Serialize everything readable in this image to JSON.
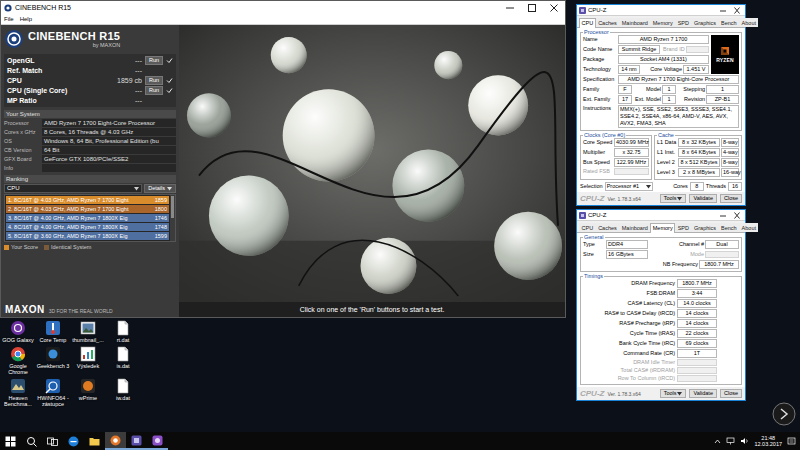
{
  "desktop": {
    "icons": [
      {
        "label": "GOG Galaxy",
        "kind": "gog"
      },
      {
        "label": "Core Temp",
        "kind": "coretemp"
      },
      {
        "label": "thumbnail_...",
        "kind": "image"
      },
      {
        "label": "rt.dat",
        "kind": "file"
      },
      {
        "label": "Google Chrome",
        "kind": "chrome"
      },
      {
        "label": "Geekbench 3",
        "kind": "geekbench"
      },
      {
        "label": "Výsledek",
        "kind": "chart"
      },
      {
        "label": "is.dat",
        "kind": "file"
      },
      {
        "label": "Heaven Benchma...",
        "kind": "heaven"
      },
      {
        "label": "HWiNFO64 - zástupce",
        "kind": "hwinfo"
      },
      {
        "label": "wPrime",
        "kind": "wprime"
      },
      {
        "label": "iw.dat",
        "kind": "file"
      }
    ]
  },
  "cinebench": {
    "title": "CINEBENCH R15",
    "menu": [
      "File",
      "Help"
    ],
    "logo": {
      "name": "CINEBENCH R15",
      "by": "by MAXON"
    },
    "tests": [
      {
        "label": "OpenGL",
        "value": "---",
        "kind": "test",
        "button": "Run",
        "checked": true
      },
      {
        "label": "Ref. Match",
        "value": "---",
        "kind": "stat"
      },
      {
        "label": "CPU",
        "value": "1859 cb",
        "kind": "test",
        "button": "Run",
        "checked": true
      },
      {
        "label": "CPU (Single Core)",
        "value": "---",
        "kind": "test",
        "button": "Run",
        "checked": true
      },
      {
        "label": "MP Ratio",
        "value": "---",
        "kind": "stat"
      }
    ],
    "system": {
      "heading": "Your System",
      "rows": [
        {
          "label": "Processor",
          "value": "AMD Ryzen 7 1700 Eight-Core Processor"
        },
        {
          "label": "Cores x GHz",
          "value": "8 Cores, 16 Threads @ 4.03 GHz"
        },
        {
          "label": "OS",
          "value": "Windows 8, 64 Bit, Professional Edition (bu"
        },
        {
          "label": "CB Version",
          "value": "64 Bit"
        },
        {
          "label": "GFX Board",
          "value": "GeForce GTX 1080/PCIe/SSE2"
        },
        {
          "label": "Info",
          "value": ""
        }
      ]
    },
    "ranking": {
      "heading": "Ranking",
      "dropdown": "CPU",
      "details": "Details",
      "rows": [
        {
          "label": "1. 8C/16T @ 4.03 GHz, AMD Ryzen 7 1700 Eight",
          "score": "1859",
          "color": "#d98c2b"
        },
        {
          "label": "2. 8C/16T @ 4.03 GHz, AMD Ryzen 7 1700 Eight",
          "score": "1800",
          "color": "#a9652a"
        },
        {
          "label": "3. 8C/16T @ 4.00 GHz, AMD Ryzen 7 1800X Eig",
          "score": "1746",
          "color": "#4f6fa0"
        },
        {
          "label": "4. 8C/16T @ 4.00 GHz, AMD Ryzen 7 1800X Eig",
          "score": "1748",
          "color": "#4f6fa0"
        },
        {
          "label": "5. 8C/16T @ 3.60 GHz, AMD Ryzen 7 1800X Eig",
          "score": "1599",
          "color": "#4f6fa0"
        }
      ],
      "legend": [
        {
          "label": "Your Score",
          "color": "#d98c2b"
        },
        {
          "label": "Identical System",
          "color": "#7a5a3a"
        }
      ]
    },
    "footer": {
      "brand": "MAXON",
      "tagline": "3D FOR THE REAL WORLD"
    },
    "status": "Click on one of the 'Run' buttons to start a test."
  },
  "cpuz_cpu": {
    "title": "CPU-Z",
    "tabs": [
      {
        "label": "CPU",
        "selected": true
      },
      {
        "label": "Caches",
        "selected": false
      },
      {
        "label": "Mainboard",
        "selected": false
      },
      {
        "label": "Memory",
        "selected": false
      },
      {
        "label": "SPD",
        "selected": false
      },
      {
        "label": "Graphics",
        "selected": false
      },
      {
        "label": "Bench",
        "selected": false
      },
      {
        "label": "About",
        "selected": false
      }
    ],
    "processor": {
      "heading": "Processor",
      "name": {
        "label": "Name",
        "value": "AMD Ryzen 7 1700"
      },
      "code_name": {
        "label": "Code Name",
        "value": "Summit Ridge"
      },
      "brand_id": {
        "label": "Brand ID",
        "value": "",
        "disabled": true
      },
      "package": {
        "label": "Package",
        "value": "Socket AM4 (1331)"
      },
      "technology": {
        "label": "Technology",
        "value": "14 nm"
      },
      "core_voltage": {
        "label": "Core Voltage",
        "value": "1.451 V"
      },
      "specification": {
        "label": "Specification",
        "value": "AMD Ryzen 7 1700 Eight-Core Processor"
      },
      "family": {
        "label": "Family",
        "value": "F"
      },
      "model": {
        "label": "Model",
        "value": "1"
      },
      "stepping": {
        "label": "Stepping",
        "value": "1"
      },
      "ext_family": {
        "label": "Ext. Family",
        "value": "17"
      },
      "ext_model": {
        "label": "Ext. Model",
        "value": "1"
      },
      "revision": {
        "label": "Revision",
        "value": "ZP-B1"
      },
      "instructions": {
        "label": "Instructions",
        "value": "MMX(+), SSE, SSE2, SSE3, SSSE3, SSE4.1, SSE4.2, SSE4A, x86-64, AMD-V, AES, AVX, AVX2, FMA3, SHA"
      },
      "logo": "RYZEN"
    },
    "clocks": {
      "heading": "Clocks (Core #0)",
      "rows": [
        {
          "label": "Core Speed",
          "value": "4030.99 MHz",
          "disabled": false
        },
        {
          "label": "Multiplier",
          "value": "x 32.75",
          "disabled": false
        },
        {
          "label": "Bus Speed",
          "value": "122.99 MHz",
          "disabled": false
        },
        {
          "label": "Rated FSB",
          "value": "",
          "disabled": true
        }
      ]
    },
    "cache": {
      "heading": "Cache",
      "rows": [
        {
          "label": "L1 Data",
          "size": "8 x 32 KBytes",
          "ways": "8-way"
        },
        {
          "label": "L1 Inst.",
          "size": "8 x 64 KBytes",
          "ways": "4-way"
        },
        {
          "label": "Level 2",
          "size": "8 x 512 KBytes",
          "ways": "8-way"
        },
        {
          "label": "Level 3",
          "size": "2 x 8 MBytes",
          "ways": "16-way"
        }
      ]
    },
    "selection": {
      "label": "Selection",
      "value": "Processor #1",
      "cores_label": "Cores",
      "cores": "8",
      "threads_label": "Threads",
      "threads": "16"
    },
    "footer": {
      "brand": "CPU-Z",
      "version": "Ver. 1.78.3.x64",
      "buttons": [
        "Tools",
        "Validate",
        "Close"
      ]
    }
  },
  "cpuz_memory": {
    "title": "CPU-Z",
    "tabs": [
      {
        "label": "CPU",
        "selected": false
      },
      {
        "label": "Caches",
        "selected": false
      },
      {
        "label": "Mainboard",
        "selected": false
      },
      {
        "label": "Memory",
        "selected": true
      },
      {
        "label": "SPD",
        "selected": false
      },
      {
        "label": "Graphics",
        "selected": false
      },
      {
        "label": "Bench",
        "selected": false
      },
      {
        "label": "About",
        "selected": false
      }
    ],
    "general": {
      "heading": "General",
      "type": {
        "label": "Type",
        "value": "DDR4"
      },
      "channel": {
        "label": "Channel #",
        "value": "Dual"
      },
      "size": {
        "label": "Size",
        "value": "16 GBytes"
      },
      "mode": {
        "label": "Mode",
        "value": "",
        "disabled": true
      },
      "nb_frequency": {
        "label": "NB Frequency",
        "value": "1800.7 MHz"
      }
    },
    "timings": {
      "heading": "Timings",
      "rows": [
        {
          "label": "DRAM Frequency",
          "value": "1800.7 MHz",
          "disabled": false
        },
        {
          "label": "FSB:DRAM",
          "value": "3:44",
          "disabled": false
        },
        {
          "label": "CAS# Latency (CL)",
          "value": "14.0 clocks",
          "disabled": false
        },
        {
          "label": "RAS# to CAS# Delay (tRCD)",
          "value": "14 clocks",
          "disabled": false
        },
        {
          "label": "RAS# Precharge (tRP)",
          "value": "14 clocks",
          "disabled": false
        },
        {
          "label": "Cycle Time (tRAS)",
          "value": "22 clocks",
          "disabled": false
        },
        {
          "label": "Bank Cycle Time (tRC)",
          "value": "69 clocks",
          "disabled": false
        },
        {
          "label": "Command Rate (CR)",
          "value": "1T",
          "disabled": false
        },
        {
          "label": "DRAM Idle Timer",
          "value": "",
          "disabled": true
        },
        {
          "label": "Total CAS# (tRDRAM)",
          "value": "",
          "disabled": true
        },
        {
          "label": "Row To Column (tRCD)",
          "value": "",
          "disabled": true
        }
      ]
    },
    "footer": {
      "brand": "CPU-Z",
      "version": "Ver. 1.78.3.x64",
      "buttons": [
        "Tools",
        "Validate",
        "Close"
      ]
    }
  },
  "taskbar": {
    "apps": [
      {
        "kind": "start",
        "open": false,
        "active": false
      },
      {
        "kind": "search",
        "open": false,
        "active": false
      },
      {
        "kind": "taskview",
        "open": false,
        "active": false
      },
      {
        "kind": "edge",
        "open": false,
        "active": false
      },
      {
        "kind": "explorer",
        "open": false,
        "active": false
      },
      {
        "kind": "cinebench",
        "open": true,
        "active": true
      },
      {
        "kind": "cpuz",
        "open": true,
        "active": false
      },
      {
        "kind": "app",
        "open": true,
        "active": false
      }
    ],
    "time": "21:48",
    "date": "12.03.2017"
  }
}
